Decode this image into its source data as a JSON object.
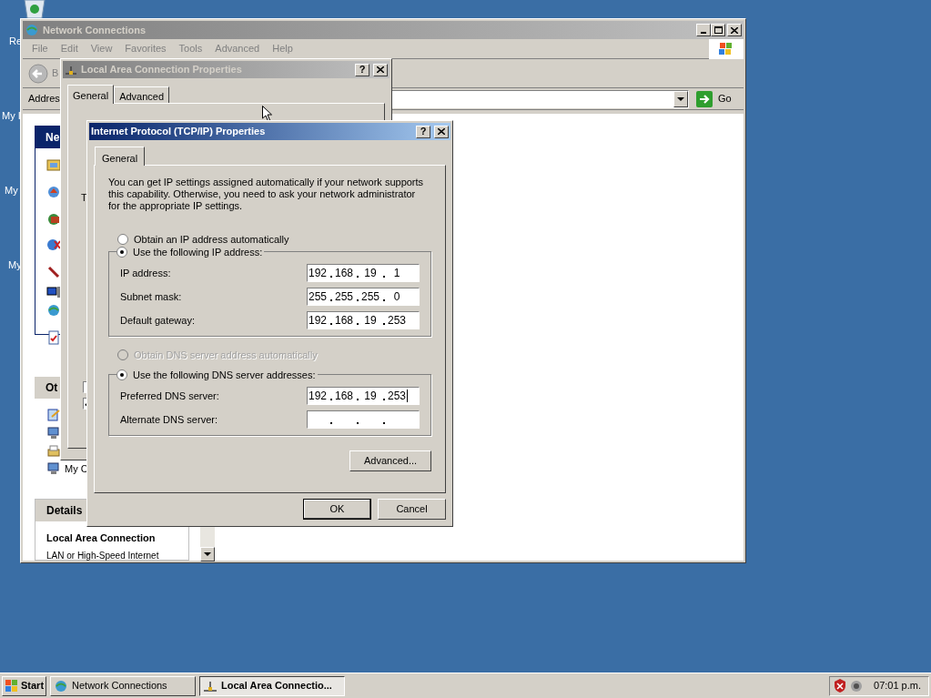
{
  "desktop": {
    "icons": [
      {
        "label": "Re"
      },
      {
        "label": "My I"
      },
      {
        "label": "My"
      },
      {
        "label": "My"
      }
    ]
  },
  "explorer": {
    "title": "Network Connections",
    "menu": [
      "File",
      "Edit",
      "View",
      "Favorites",
      "Tools",
      "Advanced",
      "Help"
    ],
    "back_label": "B",
    "address_label": "Addres",
    "go_label": "Go",
    "task_pane": {
      "tasks_header": "Ne",
      "other_header": "Ot",
      "other_item": "My C",
      "details_header": "Details",
      "details_title": "Local Area Connection",
      "details_subtitle": "LAN or High-Speed Internet"
    }
  },
  "lan_dialog": {
    "title": "Local Area Connection Properties",
    "help_button": "?",
    "tabs": [
      {
        "label": "General",
        "selected": true
      },
      {
        "label": "Advanced",
        "selected": false
      }
    ],
    "partial_label": "T",
    "checkboxes": [
      {
        "checked": false
      },
      {
        "checked": true
      }
    ]
  },
  "tcp_dialog": {
    "title": "Internet Protocol (TCP/IP) Properties",
    "help_button": "?",
    "tabs": [
      {
        "label": "General",
        "selected": true
      }
    ],
    "intro": "You can get IP settings assigned automatically if your network supports this capability. Otherwise, you need to ask your network administrator for the appropriate IP settings.",
    "ip_options": [
      {
        "label": "Obtain an IP address automatically",
        "selected": false,
        "disabled": false
      },
      {
        "label": "Use the following IP address:",
        "selected": true,
        "disabled": false
      }
    ],
    "ip_fields": [
      {
        "label": "IP address:",
        "octets": [
          "192",
          "168",
          "19",
          "1"
        ]
      },
      {
        "label": "Subnet mask:",
        "octets": [
          "255",
          "255",
          "255",
          "0"
        ]
      },
      {
        "label": "Default gateway:",
        "octets": [
          "192",
          "168",
          "19",
          "253"
        ]
      }
    ],
    "dns_options": [
      {
        "label": "Obtain DNS server address automatically",
        "selected": false,
        "disabled": true
      },
      {
        "label": "Use the following DNS server addresses:",
        "selected": true,
        "disabled": false
      }
    ],
    "dns_fields": [
      {
        "label": "Preferred DNS server:",
        "octets": [
          "192",
          "168",
          "19",
          "253"
        ]
      },
      {
        "label": "Alternate DNS server:"
      }
    ],
    "advanced_button": "Advanced...",
    "ok_button": "OK",
    "cancel_button": "Cancel"
  },
  "taskbar": {
    "start": "Start",
    "tasks": [
      {
        "label": "Network Connections",
        "selected": false
      },
      {
        "label": "Local Area Connectio...",
        "selected": true
      }
    ],
    "clock": "07:01 p.m."
  }
}
